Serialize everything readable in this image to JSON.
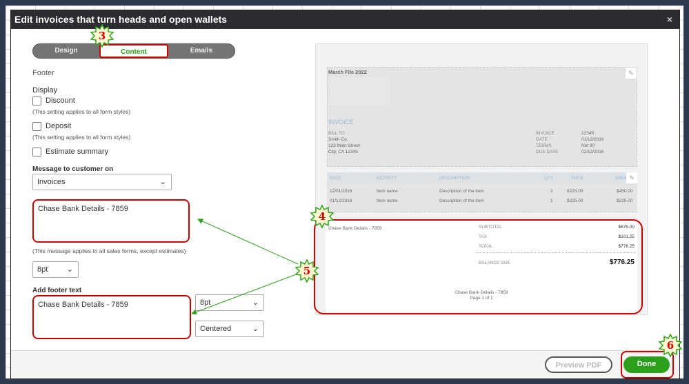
{
  "dialog": {
    "title": "Edit invoices that turn heads and open wallets",
    "close": "×"
  },
  "tabs": [
    {
      "label": "Design"
    },
    {
      "label": "Content"
    },
    {
      "label": "Emails"
    }
  ],
  "left": {
    "section": "Footer",
    "display_label": "Display",
    "discount": {
      "label": "Discount",
      "note": "(This setting applies to all form styles)"
    },
    "deposit": {
      "label": "Deposit",
      "note": "(This setting applies to all form styles)"
    },
    "estimate_summary": {
      "label": "Estimate summary"
    },
    "message_label": "Message to customer on",
    "message_on": "Invoices",
    "message_text": "Chase Bank Details - 7859",
    "message_note": "(This message applies to all sales forms, except estimates)",
    "message_size": "8pt",
    "footer_label": "Add footer text",
    "footer_text": "Chase Bank Details - 7859",
    "footer_size": "8pt",
    "footer_align": "Centered"
  },
  "preview": {
    "company": "March File 2022",
    "invoice_title": "INVOICE",
    "bill_to": "BILL TO",
    "bill_lines": [
      "Smith Co.",
      "123 Main Street",
      "City, CA 12345"
    ],
    "meta": [
      {
        "k": "INVOICE",
        "v": "12345"
      },
      {
        "k": "DATE",
        "v": "01/12/2016"
      },
      {
        "k": "TERMS",
        "v": "Net 30"
      },
      {
        "k": "DUE DATE",
        "v": "02/12/2016"
      }
    ],
    "columns": [
      "DATE",
      "ACTIVITY",
      "DESCRIPTION",
      "QTY",
      "RATE",
      "AMOU"
    ],
    "rows": [
      [
        "12/01/2016",
        "Item name",
        "Description of the item",
        "2",
        "$225.00",
        "$450.00"
      ],
      [
        "01/12/2016",
        "Item name",
        "Description of the item",
        "1",
        "$225.00",
        "$225.00"
      ]
    ],
    "message": "Chase Bank Details - 7859",
    "subtotal": {
      "k": "SUBTOTAL",
      "v": "$675.00"
    },
    "tax": {
      "k": "TAX",
      "v": "$101.25"
    },
    "total": {
      "k": "TOTAL",
      "v": "$776.25"
    },
    "balance": {
      "k": "BALANCE DUE",
      "v": "$776.25"
    },
    "footer": "Chase Bank Details - 7859",
    "page": "Page 1 of 1"
  },
  "buttons": {
    "preview": "Preview PDF",
    "done": "Done"
  },
  "annotations": {
    "step3": "3",
    "step4": "4",
    "step5": "5",
    "step6": "6"
  },
  "colors": {
    "accent": "#2ca01c",
    "annotation": "#cc0000"
  }
}
